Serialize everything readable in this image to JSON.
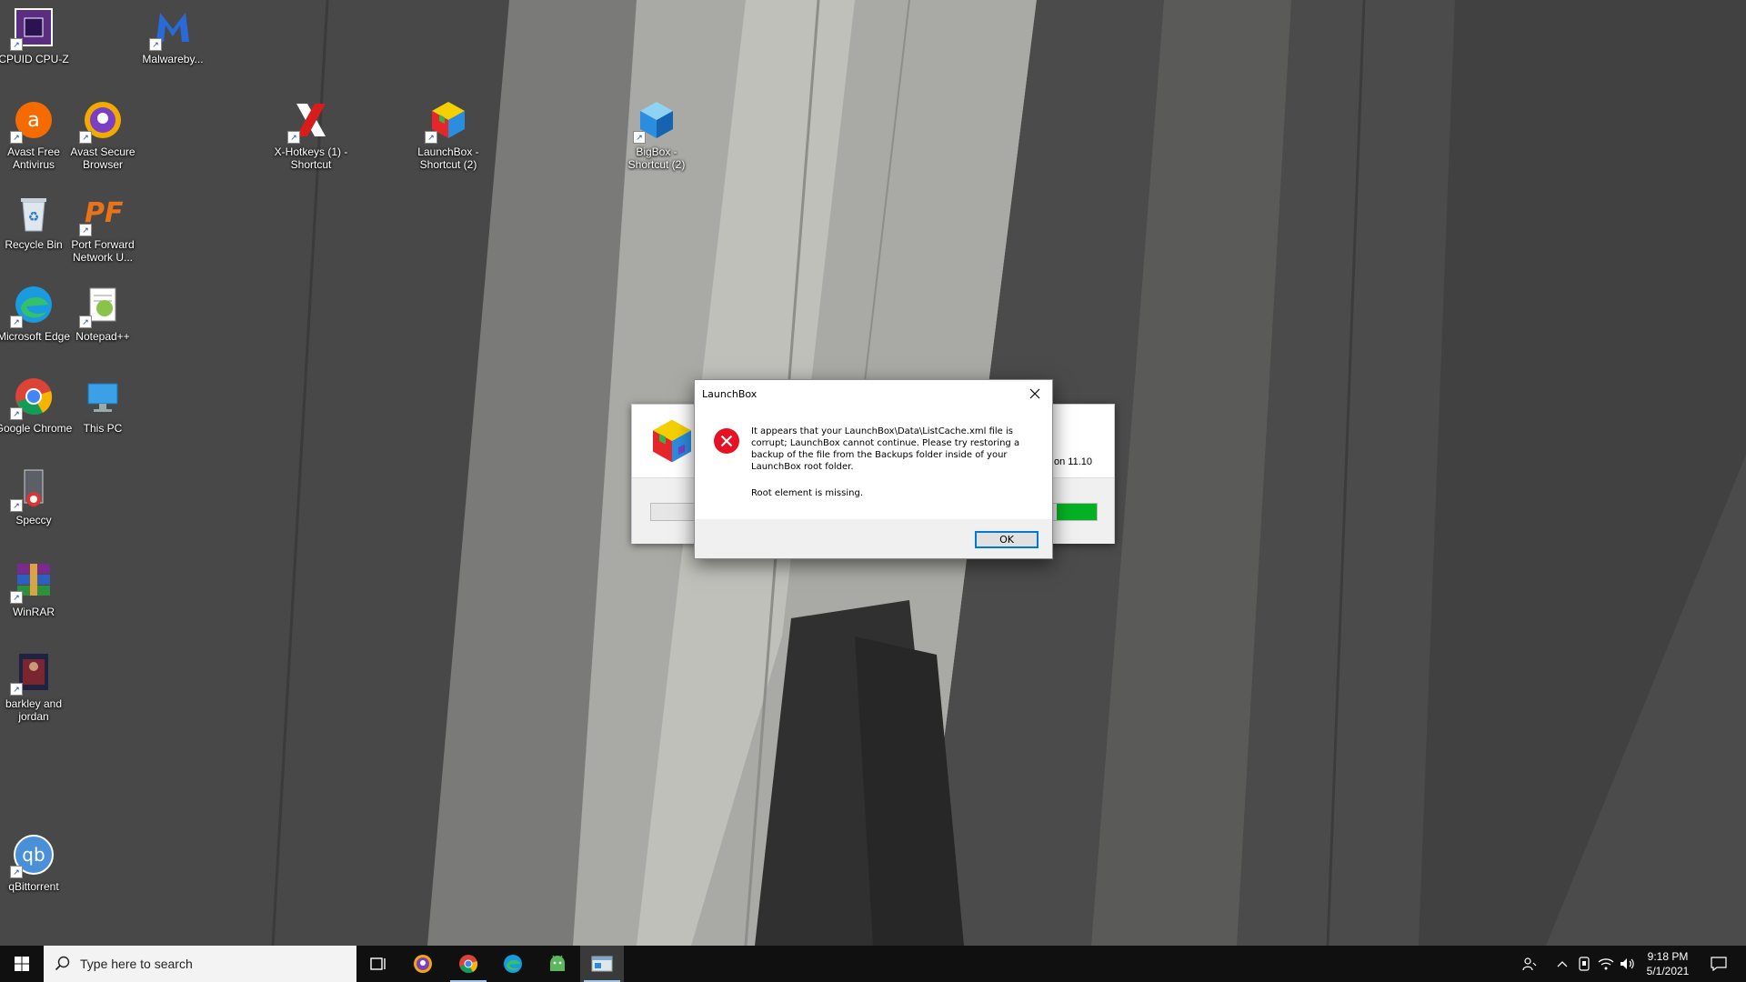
{
  "desktop": {
    "icons": [
      {
        "label": "CPUID CPU-Z"
      },
      {
        "label": "Malwareby..."
      },
      {
        "label": "Avast Free Antivirus"
      },
      {
        "label": "Avast Secure Browser"
      },
      {
        "label": "X-Hotkeys (1) - Shortcut"
      },
      {
        "label": "LaunchBox - Shortcut (2)"
      },
      {
        "label": "BigBox - Shortcut (2)"
      },
      {
        "label": "Recycle Bin"
      },
      {
        "label": "Port Forward Network U..."
      },
      {
        "label": "Microsoft Edge"
      },
      {
        "label": "Notepad++"
      },
      {
        "label": "Google Chrome"
      },
      {
        "label": "This PC"
      },
      {
        "label": "Speccy"
      },
      {
        "label": "WinRAR"
      },
      {
        "label": "barkley and jordan"
      },
      {
        "label": "qBittorrent"
      }
    ]
  },
  "splash": {
    "version_text": "on 11.10",
    "progress": 0.09
  },
  "dialog": {
    "title": "LaunchBox",
    "message": "It appears that your LaunchBox\\Data\\ListCache.xml file is corrupt; LaunchBox cannot continue. Please try restoring a backup of the file from the Backups folder inside of your LaunchBox root folder.",
    "detail": "Root element is missing.",
    "ok_label": "OK"
  },
  "taskbar": {
    "search_placeholder": "Type here to search",
    "apps": [
      "task-view",
      "avast-secure-browser",
      "google-chrome",
      "microsoft-edge",
      "android-app",
      "launchbox"
    ],
    "clock": {
      "time": "9:18 PM",
      "date": "5/1/2021"
    }
  },
  "colors": {
    "taskbar_bg": "#101010",
    "accent": "#0078d7",
    "progress_green": "#06b025",
    "error_red": "#e81123"
  }
}
